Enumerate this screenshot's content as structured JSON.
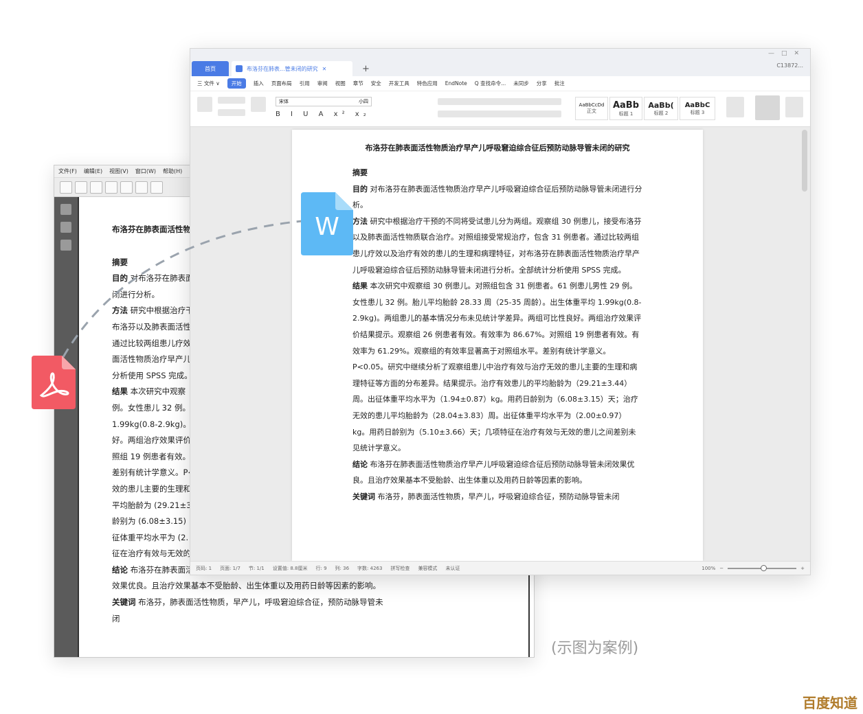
{
  "pdf_window": {
    "menu": [
      "文件(F)",
      "编辑(E)",
      "视图(V)",
      "窗口(W)",
      "帮助(H)"
    ],
    "title": "布洛芬在肺表面活性物",
    "abstract_heading": "摘要",
    "lines": [
      {
        "kw": "目的",
        "text": "对布洛芬在肺表面"
      },
      {
        "kw": "",
        "text": "闭进行分析。"
      },
      {
        "kw": "方法",
        "text": "研究中根据治疗干"
      },
      {
        "kw": "",
        "text": "布洛芬以及肺表面活性"
      },
      {
        "kw": "",
        "text": "通过比较两组患儿疗效"
      },
      {
        "kw": "",
        "text": "面活性物质治疗早产儿"
      },
      {
        "kw": "",
        "text": "分析使用 SPSS 完成。"
      },
      {
        "kw": "结果",
        "text": "本次研究中观察"
      },
      {
        "kw": "",
        "text": "例。女性患儿 32 例。"
      },
      {
        "kw": "",
        "text": "1.99kg(0.8-2.9kg)。"
      },
      {
        "kw": "",
        "text": "好。两组治疗效果评价"
      },
      {
        "kw": "",
        "text": "照组 19 例患者有效。"
      },
      {
        "kw": "",
        "text": "差别有统计学意义。P<"
      },
      {
        "kw": "",
        "text": "效的患儿主要的生理和"
      },
      {
        "kw": "",
        "text": "平均胎龄为 (29.21±3"
      },
      {
        "kw": "",
        "text": "龄别为 (6.08±3.15)"
      },
      {
        "kw": "",
        "text": "征体重平均水平为 (2."
      },
      {
        "kw": "",
        "text": "征在治疗有效与无效的"
      },
      {
        "kw": "结论",
        "text": "布洛芬在肺表面活"
      },
      {
        "kw": "",
        "text": "效果优良。且治疗效果基本不受胎龄、出生体重以及用药日龄等因素的影响。"
      },
      {
        "kw": "关键词",
        "text": "布洛芬，肺表面活性物质，早产儿，呼吸窘迫综合征，预防动脉导管未"
      },
      {
        "kw": "",
        "text": "闭"
      }
    ]
  },
  "word_window": {
    "tab_home": "首页",
    "tab_doc": "布洛芬在肺表...管未闭的研究",
    "account": "C13872...",
    "menu": [
      "三 文件 ∨",
      "开始",
      "插入",
      "页面布局",
      "引用",
      "审阅",
      "视图",
      "章节",
      "安全",
      "开发工具",
      "特色应用",
      "EndNote",
      "Q 查找命令...",
      "未同步",
      "分享",
      "批注"
    ],
    "active_menu": "开始",
    "font_name": "宋体",
    "font_size": "小四",
    "styles": [
      {
        "preview": "AaBbCcDd",
        "name": "正文"
      },
      {
        "preview": "AaBb",
        "name": "标题 1"
      },
      {
        "preview": "AaBb(",
        "name": "标题 2"
      },
      {
        "preview": "AaBbC",
        "name": "标题 3"
      }
    ],
    "doc_title": "布洛芬在肺表面活性物质治疗早产儿呼吸窘迫综合征后预防动脉导管未闭的研究",
    "abstract_heading": "摘要",
    "paragraphs": [
      {
        "kw": "目的",
        "text": "对布洛芬在肺表面活性物质治疗早产儿呼吸窘迫综合征后预防动脉导管未闭进行分析。"
      },
      {
        "kw": "方法",
        "text": "研究中根据治疗干预的不同将受试患儿分为两组。观察组 30 例患儿，接受布洛芬以及肺表面活性物质联合治疗。对照组接受常规治疗，包含 31 例患者。通过比较两组患儿疗效以及治疗有效的患儿的生理和病理特征，对布洛芬在肺表面活性物质治疗早产儿呼吸窘迫综合征后预防动脉导管未闭进行分析。全部统计分析使用 SPSS 完成。"
      },
      {
        "kw": "结果",
        "text": "本次研究中观察组 30 例患儿。对照组包含 31 例患者。61 例患儿男性 29 例。女性患儿 32 例。胎儿平均胎龄 28.33 周（25-35 周龄）。出生体重平均 1.99kg(0.8-2.9kg)。两组患儿的基本情况分布未见统计学差异。两组可比性良好。两组治疗效果评价结果提示。观察组 26 例患者有效。有效率为 86.67%。对照组 19 例患者有效。有效率为 61.29%。观察组的有效率显著高于对照组水平。差别有统计学意义。P<0.05。研究中继续分析了观察组患儿中治疗有效与治疗无效的患儿主要的生理和病理特征等方面的分布差异。结果提示。治疗有效患儿的平均胎龄为（29.21±3.44）周。出征体重平均水平为（1.94±0.87）kg。用药日龄别为（6.08±3.15）天；治疗无效的患儿平均胎龄为（28.04±3.83）周。出征体重平均水平为（2.00±0.97）kg。用药日龄别为（5.10±3.66）天；几项特征在治疗有效与无效的患儿之间差别未见统计学意义。"
      },
      {
        "kw": "结论",
        "text": "布洛芬在肺表面活性物质治疗早产儿呼吸窘迫综合征后预防动脉导管未闭效果优良。且治疗效果基本不受胎龄、出生体重以及用药日龄等因素的影响。"
      },
      {
        "kw": "关键词",
        "text": "布洛芬，肺表面活性物质，早产儿，呼吸窘迫综合征，预防动脉导管未闭"
      }
    ],
    "status": {
      "page": "页码: 1",
      "pages": "页面: 1/7",
      "section": "节: 1/1",
      "position": "设置值: 8.8厘米",
      "row": "行: 9",
      "col": "列: 36",
      "words": "字数: 4263",
      "spell": "拼写检查",
      "mode": "兼容模式",
      "auth": "未认证",
      "zoom": "100%"
    }
  },
  "caption": "(示图为案例)",
  "logo": "百度知道",
  "colors": {
    "accent": "#4a7be5",
    "word_icon": "#5db9f5",
    "pdf_icon": "#f25a64"
  }
}
